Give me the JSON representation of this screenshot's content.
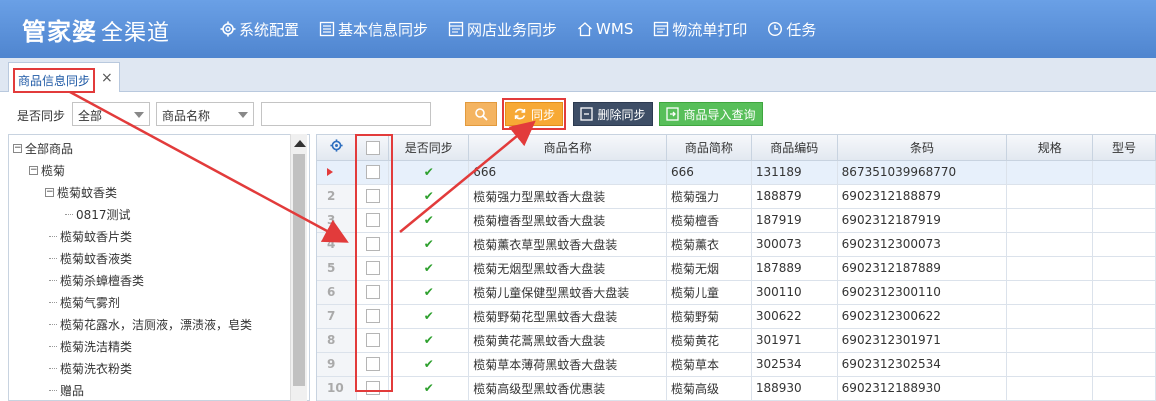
{
  "app": {
    "logo_main": "管家婆",
    "logo_sub": "全渠道"
  },
  "nav": [
    {
      "label": "系统配置",
      "icon": "gear-icon"
    },
    {
      "label": "基本信息同步",
      "icon": "list-icon"
    },
    {
      "label": "网店业务同步",
      "icon": "document-icon"
    },
    {
      "label": "WMS",
      "icon": "home-icon"
    },
    {
      "label": "物流单打印",
      "icon": "document-icon"
    },
    {
      "label": "任务",
      "icon": "clock-icon"
    }
  ],
  "tab": {
    "label": "商品信息同步",
    "close": "×"
  },
  "toolbar": {
    "sync_filter_label": "是否同步",
    "sync_filter_value": "全部",
    "field_select_value": "商品名称",
    "search_value": "",
    "sync_button": "同步",
    "delete_sync_button": "删除同步",
    "import_query_button": "商品导入查询"
  },
  "tree": {
    "root": "全部商品",
    "brand": "榄菊",
    "category": "榄菊蚊香类",
    "sub": "0817测试",
    "items": [
      "榄菊蚊香片类",
      "榄菊蚊香液类",
      "榄菊杀蟑檀香类",
      "榄菊气雾剂",
      "榄菊花露水，洁厕液，漂渍液，皂类",
      "榄菊洗洁精类",
      "榄菊洗衣粉类",
      "赠品"
    ]
  },
  "grid": {
    "headers": [
      "是否同步",
      "商品名称",
      "商品简称",
      "商品编码",
      "条码",
      "规格",
      "型号"
    ],
    "rows": [
      {
        "num": "",
        "name": "666",
        "short": "666",
        "code": "131189",
        "barcode": "867351039968770",
        "sync": "✔",
        "selected": true
      },
      {
        "num": "2",
        "name": "榄菊强力型黑蚊香大盘装",
        "short": "榄菊强力",
        "code": "188879",
        "barcode": "6902312188879",
        "sync": "✔"
      },
      {
        "num": "3",
        "name": "榄菊檀香型黑蚊香大盘装",
        "short": "榄菊檀香",
        "code": "187919",
        "barcode": "6902312187919",
        "sync": "✔"
      },
      {
        "num": "4",
        "name": "榄菊薰衣草型黑蚊香大盘装",
        "short": "榄菊薰衣",
        "code": "300073",
        "barcode": "6902312300073",
        "sync": "✔"
      },
      {
        "num": "5",
        "name": "榄菊无烟型黑蚊香大盘装",
        "short": "榄菊无烟",
        "code": "187889",
        "barcode": "6902312187889",
        "sync": "✔"
      },
      {
        "num": "6",
        "name": "榄菊儿童保健型黑蚊香大盘装",
        "short": "榄菊儿童",
        "code": "300110",
        "barcode": "6902312300110",
        "sync": "✔"
      },
      {
        "num": "7",
        "name": "榄菊野菊花型黑蚊香大盘装",
        "short": "榄菊野菊",
        "code": "300622",
        "barcode": "6902312300622",
        "sync": "✔"
      },
      {
        "num": "8",
        "name": "榄菊黄花蒿黑蚊香大盘装",
        "short": "榄菊黄花",
        "code": "301971",
        "barcode": "6902312301971",
        "sync": "✔"
      },
      {
        "num": "9",
        "name": "榄菊草本薄荷黑蚊香大盘装",
        "short": "榄菊草本",
        "code": "302534",
        "barcode": "6902312302534",
        "sync": "✔"
      },
      {
        "num": "10",
        "name": "榄菊高级型黑蚊香优惠装",
        "short": "榄菊高级",
        "code": "188930",
        "barcode": "6902312188930",
        "sync": "✔"
      }
    ]
  },
  "colors": {
    "topbar": "#5b8fd6",
    "annotation_red": "#e23b3b",
    "sync_button": "#f7a935",
    "delete_button": "#3e4e66",
    "import_button": "#58bf5a",
    "check_green": "#2ea02e"
  }
}
